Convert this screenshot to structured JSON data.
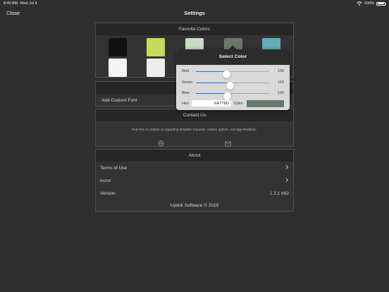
{
  "status_bar": {
    "time": "8:40 AM",
    "date": "Wed Jul 3",
    "battery": "100%"
  },
  "nav": {
    "title": "Settings",
    "close_label": "Close"
  },
  "favorites": {
    "header": "Favorite Colors",
    "swatches": [
      {
        "color": "#111111"
      },
      {
        "color": "#c5d95a"
      },
      {
        "color": "#c9d9c3"
      },
      {
        "color": "#6a776d"
      },
      {
        "color": "#62aeb8"
      },
      {
        "color": "#f5f5f5"
      },
      {
        "color": "#ececec"
      }
    ]
  },
  "custom_font": {
    "label": "Add Custom Font"
  },
  "contact": {
    "header": "Contact Us",
    "description": "Feel free to contact us regarding template requests, custom options, and app feedback."
  },
  "about": {
    "header": "About",
    "terms_label": "Terms of Use",
    "icons_label": "Icons",
    "version_label": "Version",
    "version_value": "1.2.1 b62",
    "footer": "Uplink Software © 2019"
  },
  "color_picker": {
    "title": "Select Color",
    "red_label": "Red",
    "red_value": "106",
    "green_label": "Green",
    "green_value": "119",
    "blue_label": "Blue",
    "blue_value": "109",
    "hex_label": "Hex",
    "hex_value": "6A776D",
    "color_label": "Color",
    "preview_color": "#6a776d",
    "accent_color": "#1a7ad9"
  }
}
